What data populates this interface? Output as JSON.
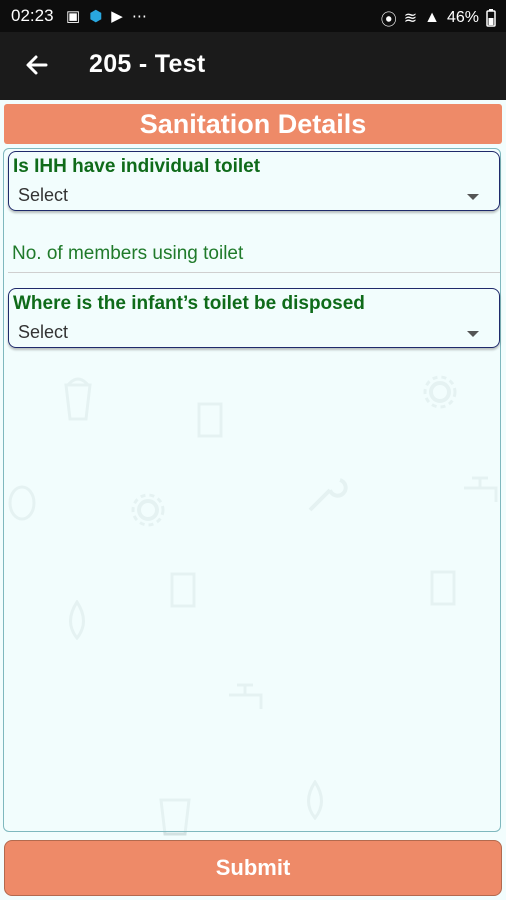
{
  "status_bar": {
    "time": "02:23",
    "battery": "46%",
    "left_icons": [
      "image-icon",
      "shield-dot-icon",
      "play-icon",
      "more-dots-icon"
    ],
    "right_icons": [
      "location-icon",
      "wifi-icon",
      "signal-icon"
    ]
  },
  "appbar": {
    "title": "205 - Test",
    "back_icon": "arrow-left-icon"
  },
  "section": {
    "title": "Sanitation Details"
  },
  "form": {
    "toilet_question": {
      "label": "Is IHH have individual toilet",
      "value": "Select"
    },
    "members_field": {
      "placeholder": "No. of members using toilet",
      "value": ""
    },
    "infant_disposal_question": {
      "label": "Where is the infant’s toilet be disposed",
      "value": "Select"
    }
  },
  "submit": {
    "label": "Submit"
  },
  "colors": {
    "accent": "#ee8a68",
    "label_green": "#0f6b1a",
    "background": "#f2fdfd",
    "appbar": "#1b1b1b"
  }
}
